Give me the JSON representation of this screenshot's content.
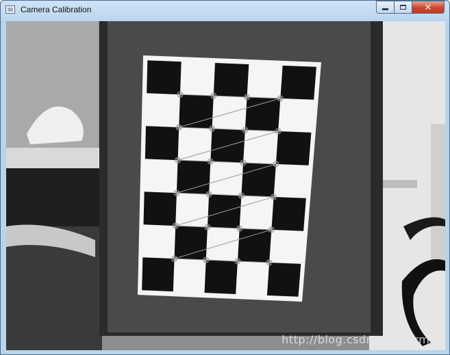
{
  "window": {
    "title": "Camera Calibration",
    "icon": "app-window-icon",
    "controls": {
      "minimize": "minimize-icon",
      "maximize": "maximize-icon",
      "close": "close-icon"
    }
  },
  "image": {
    "watermark": "http://blog.csdn.net/dcrmg",
    "board": {
      "columns": 5,
      "rows": 7,
      "detected_corner_grid": "4x6"
    },
    "colors": {
      "corner_marker": "#9a9a9a",
      "board_white": "#f5f5f5",
      "board_black": "#111111"
    }
  }
}
